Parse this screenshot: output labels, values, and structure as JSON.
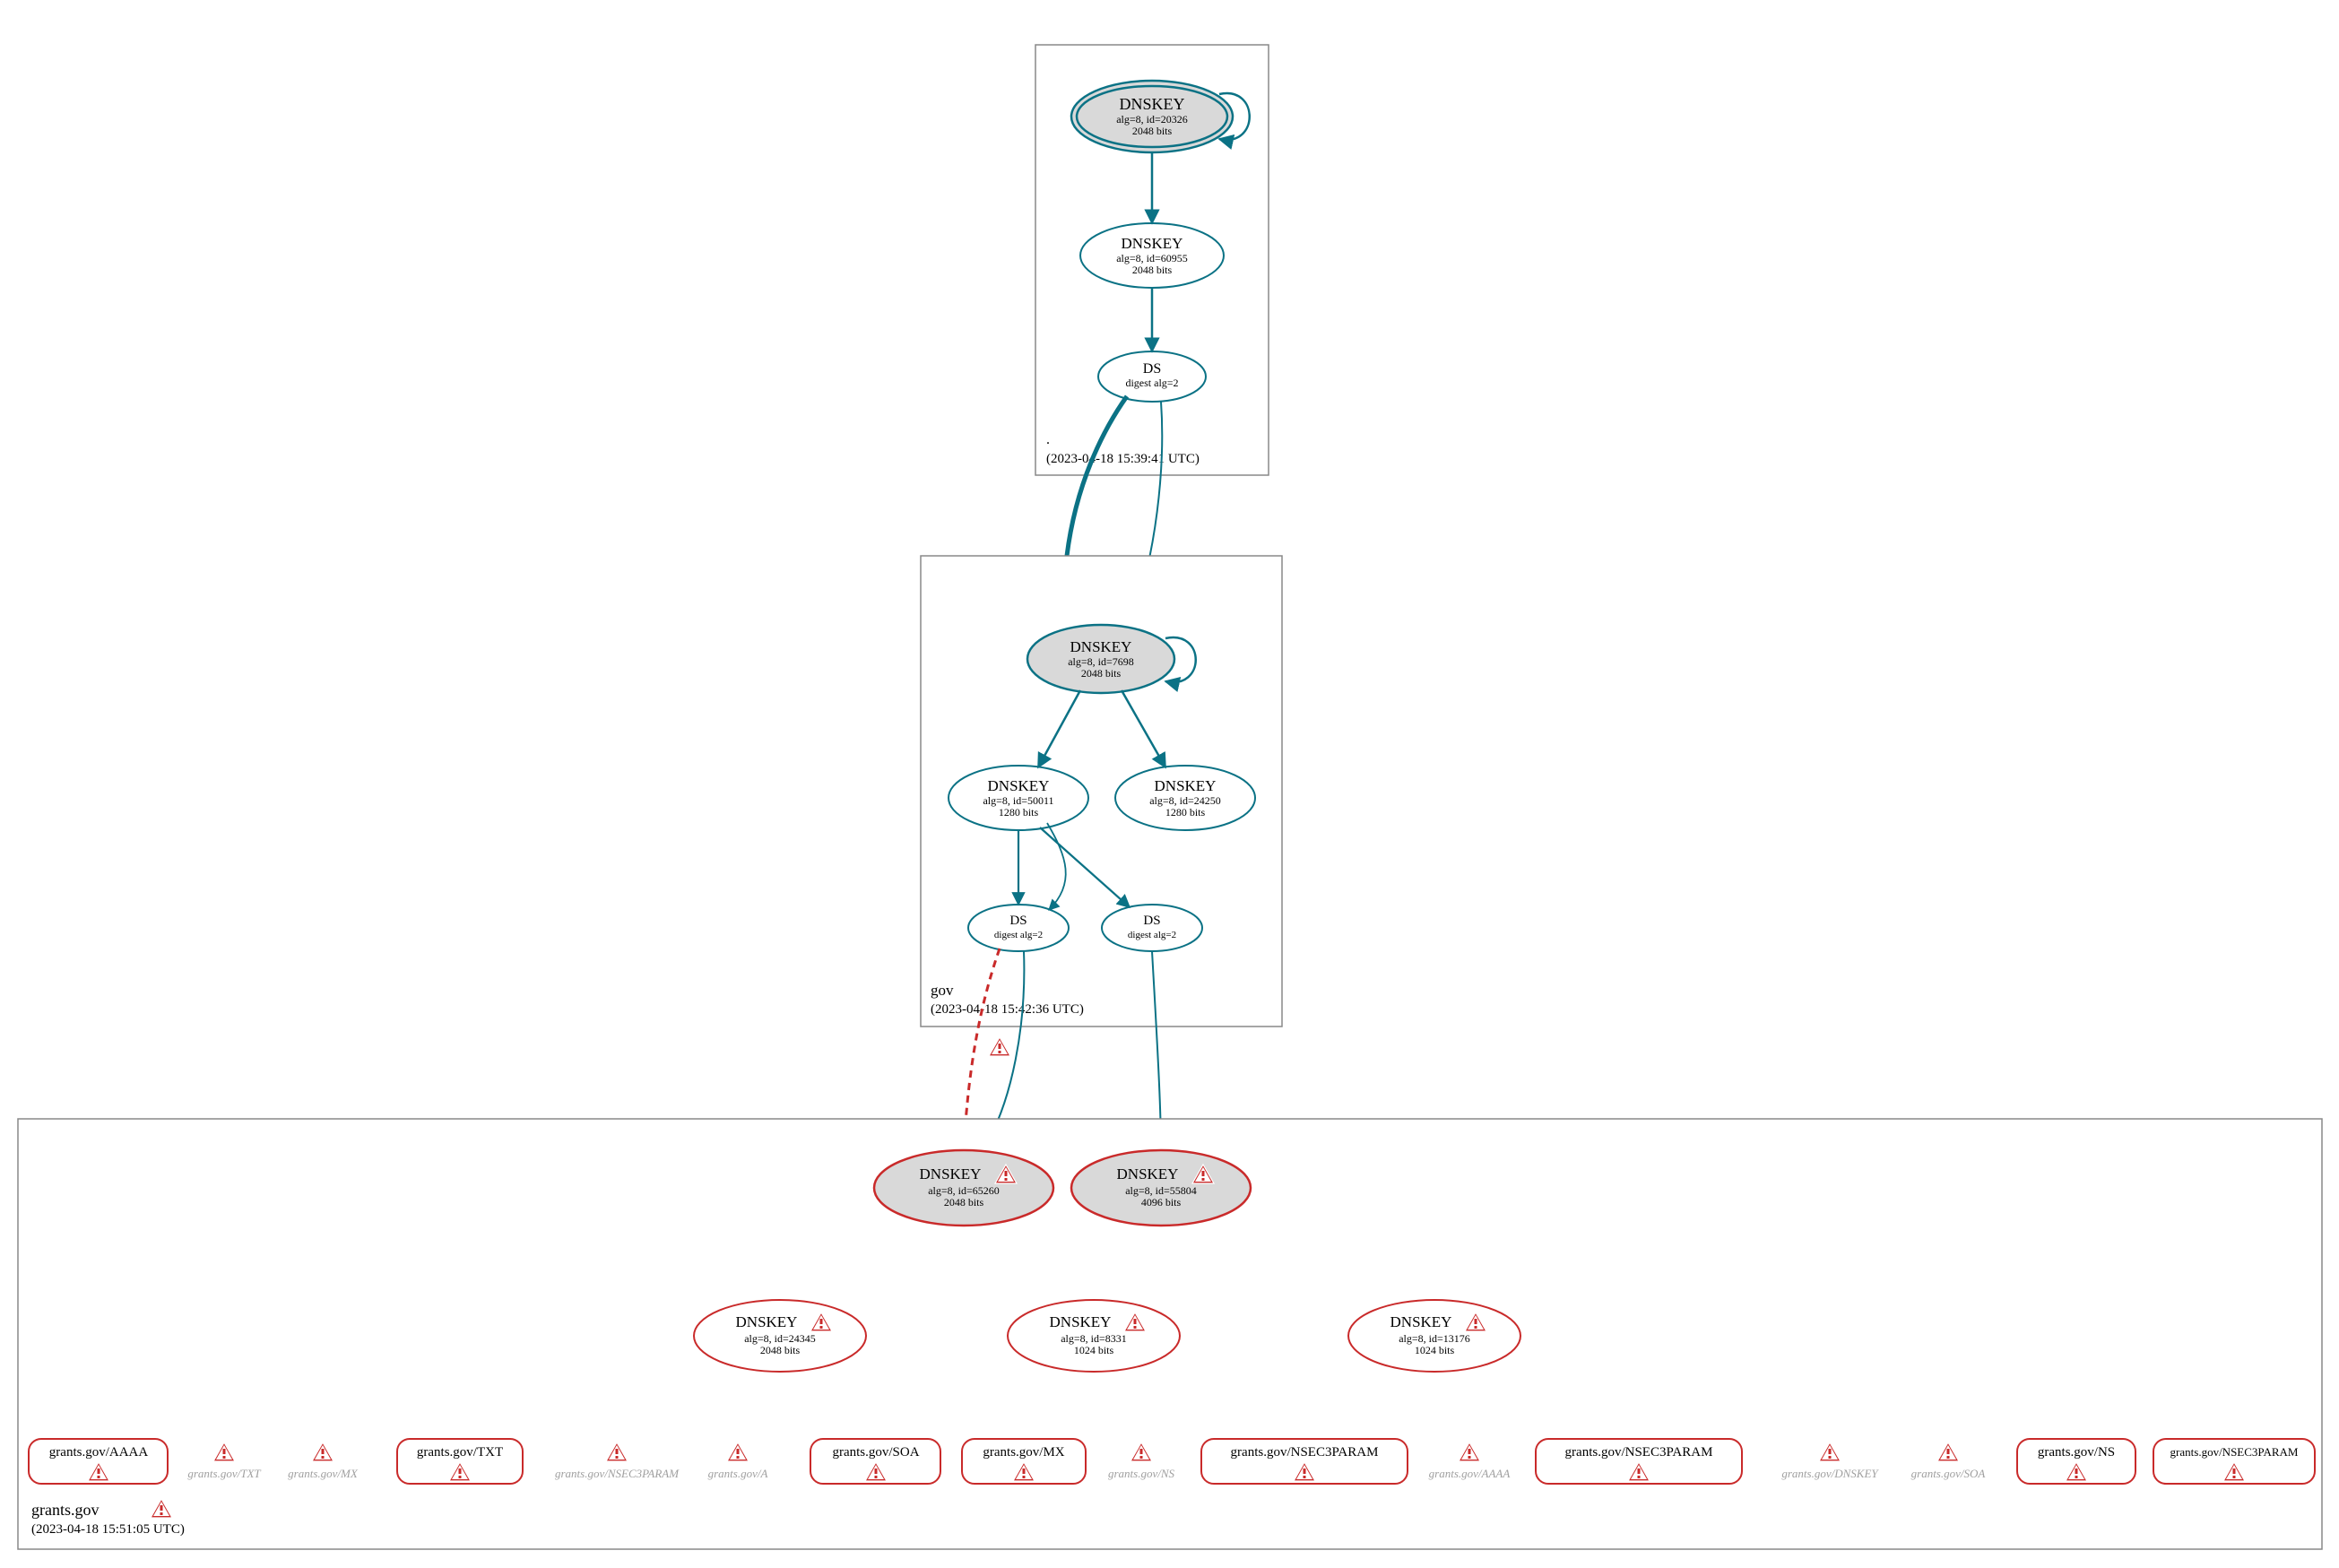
{
  "colors": {
    "teal": "#0b7285",
    "red": "#c92a2a",
    "grey": "#d9d9d9",
    "greyStroke": "#888888",
    "lightText": "#a0a0a0"
  },
  "zones": {
    "root": {
      "label": ".",
      "timestamp": "(2023-04-18 15:39:41 UTC)",
      "nodes": {
        "ksk": {
          "title": "DNSKEY",
          "line2": "alg=8, id=20326",
          "line3": "2048 bits"
        },
        "zsk": {
          "title": "DNSKEY",
          "line2": "alg=8, id=60955",
          "line3": "2048 bits"
        },
        "ds": {
          "title": "DS",
          "line2": "digest alg=2"
        }
      }
    },
    "gov": {
      "label": "gov",
      "timestamp": "(2023-04-18 15:42:36 UTC)",
      "nodes": {
        "ksk": {
          "title": "DNSKEY",
          "line2": "alg=8, id=7698",
          "line3": "2048 bits"
        },
        "zsk1": {
          "title": "DNSKEY",
          "line2": "alg=8, id=50011",
          "line3": "1280 bits"
        },
        "zsk2": {
          "title": "DNSKEY",
          "line2": "alg=8, id=24250",
          "line3": "1280 bits"
        },
        "ds1": {
          "title": "DS",
          "line2": "digest alg=2"
        },
        "ds2": {
          "title": "DS",
          "line2": "digest alg=2"
        }
      }
    },
    "grants": {
      "label": "grants.gov",
      "timestamp": "(2023-04-18 15:51:05 UTC)",
      "nodes": {
        "k65260": {
          "title": "DNSKEY",
          "line2": "alg=8, id=65260",
          "line3": "2048 bits"
        },
        "k55804": {
          "title": "DNSKEY",
          "line2": "alg=8, id=55804",
          "line3": "4096 bits"
        },
        "k24345": {
          "title": "DNSKEY",
          "line2": "alg=8, id=24345",
          "line3": "2048 bits"
        },
        "k8331": {
          "title": "DNSKEY",
          "line2": "alg=8, id=8331",
          "line3": "1024 bits"
        },
        "k13176": {
          "title": "DNSKEY",
          "line2": "alg=8, id=13176",
          "line3": "1024 bits"
        }
      },
      "rrsets": {
        "r1": "grants.gov/AAAA",
        "r2": "grants.gov/TXT",
        "r3": "grants.gov/MX",
        "r4": "grants.gov/NSEC3PARAM",
        "r5": "grants.gov/A",
        "r6": "grants.gov/TXT",
        "r7": "grants.gov/SOA",
        "r8": "grants.gov/MX",
        "r9": "grants.gov/NS",
        "r10": "grants.gov/NSEC3PARAM",
        "r11": "grants.gov/NSEC3PARAM",
        "r12": "grants.gov/AAAA",
        "r13": "grants.gov/DNSKEY",
        "r14": "grants.gov/SOA",
        "r15": "grants.gov/NS",
        "r16": "grants.gov/NSEC3PARAM"
      }
    }
  }
}
